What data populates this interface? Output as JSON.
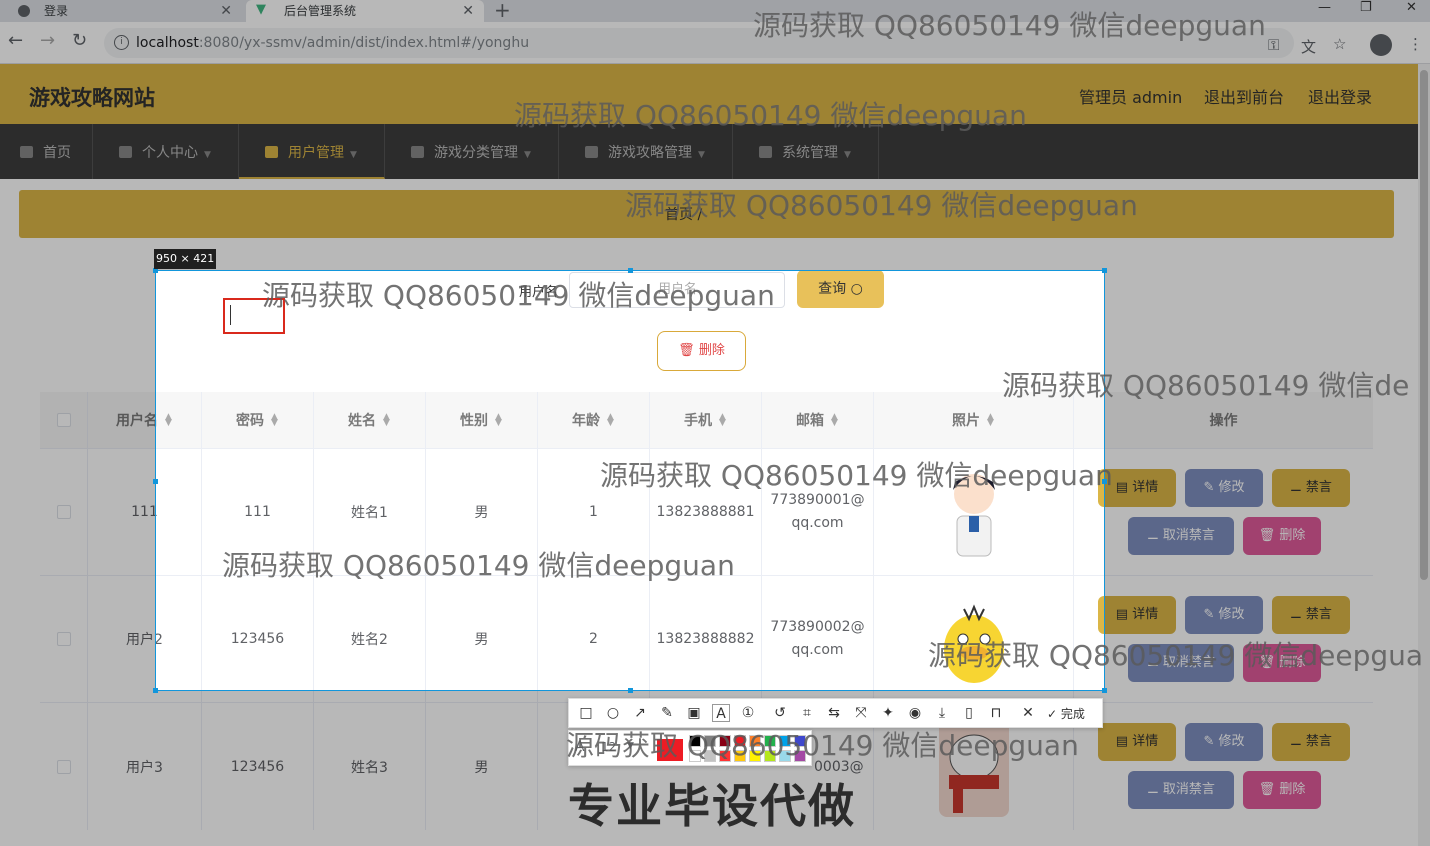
{
  "browser": {
    "tabs": [
      {
        "title": "登录"
      },
      {
        "title": "后台管理系统"
      }
    ],
    "url_host": "localhost",
    "url_rest": ":8080/yx-ssmv/admin/dist/index.html#/yonghu"
  },
  "header": {
    "brand": "游戏攻略网站",
    "links": [
      "管理员 admin",
      "退出到前台",
      "退出登录"
    ]
  },
  "menu": [
    {
      "label": "首页"
    },
    {
      "label": "个人中心"
    },
    {
      "label": "用户管理"
    },
    {
      "label": "游戏分类管理"
    },
    {
      "label": "游戏攻略管理"
    },
    {
      "label": "系统管理"
    }
  ],
  "breadcrumb": "首页 /",
  "search": {
    "label": "用户名",
    "placeholder": "用户名",
    "query_button": "查询",
    "delete_button": "删除"
  },
  "table": {
    "columns": [
      "用户名",
      "密码",
      "姓名",
      "性别",
      "年龄",
      "手机",
      "邮箱",
      "照片",
      "操作"
    ],
    "rows": [
      {
        "username": "111",
        "password": "111",
        "name": "姓名1",
        "gender": "男",
        "age": "1",
        "phone": "13823888881",
        "email1": "773890001@",
        "email2": "qq.com"
      },
      {
        "username": "用户2",
        "password": "123456",
        "name": "姓名2",
        "gender": "男",
        "age": "2",
        "phone": "13823888882",
        "email1": "773890002@",
        "email2": "qq.com"
      },
      {
        "username": "用户3",
        "password": "123456",
        "name": "姓名3",
        "gender": "男",
        "age": "",
        "phone": "",
        "email1": "0003@",
        "email2": ""
      }
    ],
    "actions": {
      "detail": "详情",
      "edit": "修改",
      "ban": "禁言",
      "unban": "取消禁言",
      "delete": "删除"
    }
  },
  "capture": {
    "size_label": "950 × 421",
    "done_label": "完成",
    "font_size": "12",
    "swatches": [
      "#000000",
      "#7f7f7f",
      "#880015",
      "#ed1c24",
      "#ff7f27",
      "#22b14c",
      "#00a2e8",
      "#3f48cc",
      "#ffffff",
      "#c3c3c3",
      "#ff3333",
      "#ffc90e",
      "#fff200",
      "#b5e61d",
      "#99d9ea",
      "#a349a4"
    ],
    "current_color": "#ed1c24"
  },
  "watermark": {
    "text": "源码获取 QQ86050149 微信deepguan",
    "cut_text_1": "源码获取 QQ86050149 微信de",
    "cut_text_2": "源码获取 QQ86050149 微信deepgua",
    "banner": "专业毕设代做"
  }
}
